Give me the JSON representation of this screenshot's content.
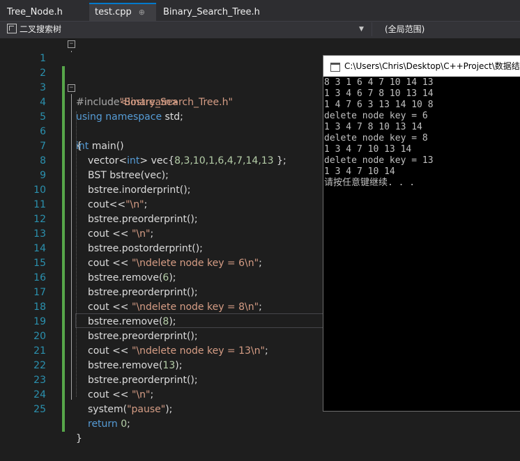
{
  "tabs": [
    {
      "label": "Tree_Node.h",
      "active": false
    },
    {
      "label": "test.cpp",
      "active": true,
      "pin": "⊕"
    },
    {
      "label": "Binary_Search_Tree.h",
      "active": false
    }
  ],
  "nav": {
    "scope_label": "二叉搜索树",
    "member_label": "(全局范围)"
  },
  "line_numbers": [
    "1",
    "2",
    "3",
    "4",
    "5",
    "6",
    "7",
    "8",
    "9",
    "10",
    "11",
    "12",
    "13",
    "14",
    "15",
    "16",
    "17",
    "18",
    "19",
    "20",
    "21",
    "22",
    "23",
    "24",
    "25"
  ],
  "code": {
    "l1": {
      "pp": "#include",
      "str": "\"Binary_Search_Tree.h\""
    },
    "l2": {
      "pp": "#include",
      "str": "<iostream>"
    },
    "l3": {
      "kw1": "using",
      "kw2": "namespace",
      "rest": " std;"
    },
    "l4": {
      "kw": "int",
      "rest": " main()"
    },
    "l5": {
      "text": "{"
    },
    "l6": {
      "a": "vector<",
      "kw": "int",
      "b": "> vec{",
      "nums": "8,3,10,1,6,4,7,14,13",
      "c": " };"
    },
    "l7": {
      "text": "BST bstree(vec);"
    },
    "l8": {
      "text": "bstree.inorderprint();"
    },
    "l9": {
      "a": "cout<<",
      "str": "\"\\n\"",
      "b": ";"
    },
    "l10": {
      "text": "bstree.preorderprint();"
    },
    "l11": {
      "a": "cout << ",
      "str": "\"\\n\"",
      "b": ";"
    },
    "l12": {
      "text": "bstree.postorderprint();"
    },
    "l13": {
      "a": "cout << ",
      "str": "\"\\ndelete node key = 6\\n\"",
      "b": ";"
    },
    "l14": {
      "a": "bstree.remove(",
      "num": "6",
      "b": ");"
    },
    "l15": {
      "text": "bstree.preorderprint();"
    },
    "l16": {
      "a": "cout << ",
      "str": "\"\\ndelete node key = 8\\n\"",
      "b": ";"
    },
    "l17": {
      "a": "bstree.remove(",
      "num": "8",
      "b": ");"
    },
    "l18": {
      "text": "bstree.preorderprint();"
    },
    "l19": {
      "a": "cout << ",
      "str": "\"\\ndelete node key = 13\\n\"",
      "b": ";"
    },
    "l20": {
      "a": "bstree.remove(",
      "num": "13",
      "b": ");"
    },
    "l21": {
      "text": "bstree.preorderprint();"
    },
    "l22": {
      "a": "cout << ",
      "str": "\"\\n\"",
      "b": ";"
    },
    "l23": {
      "a": "system(",
      "str": "\"pause\"",
      "b": ");"
    },
    "l24": {
      "kw": "return",
      "num": " 0",
      "b": ";"
    },
    "l25": {
      "text": "}"
    }
  },
  "console": {
    "title": "C:\\Users\\Chris\\Desktop\\C++Project\\数据结构",
    "lines": [
      "8 3 1 6 4 7 10 14 13",
      "1 3 4 6 7 8 10 13 14",
      "1 4 7 6 3 13 14 10 8",
      "delete node key = 6",
      "1 3 4 7 8 10 13 14",
      "delete node key = 8",
      "1 3 4 7 10 13 14",
      "delete node key = 13",
      "1 3 4 7 10 14",
      "请按任意键继续. . ."
    ]
  },
  "colors": {
    "background": "#1e1e1e",
    "keyword": "#569cd6",
    "string": "#d69d85",
    "number": "#b5cea8",
    "line_number": "#2b91af",
    "change_bar": "#57a64a"
  }
}
